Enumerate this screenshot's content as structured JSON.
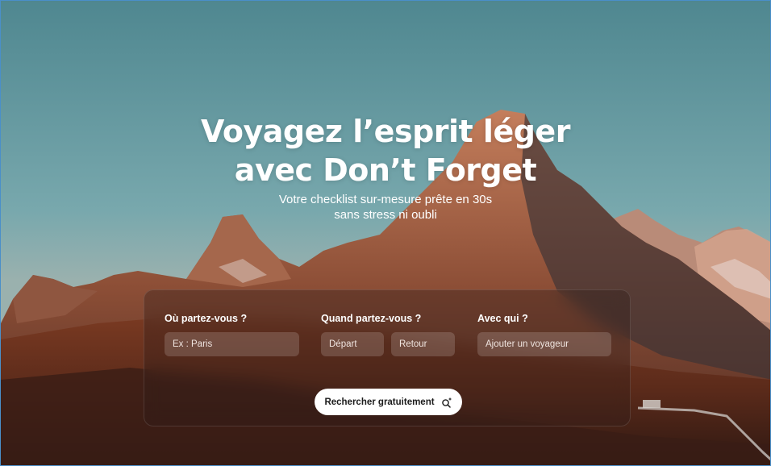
{
  "hero": {
    "headline_line1": "Voyagez l’esprit léger",
    "headline_line2": "avec Don’t Forget",
    "subtitle_line1": "Votre checklist sur-mesure prête en 30s",
    "subtitle_line2": "sans stress ni oubli"
  },
  "search": {
    "destination_label": "Où partez-vous ?",
    "destination_placeholder": "Ex : Paris",
    "dates_label": "Quand partez-vous ?",
    "departure_placeholder": "Départ",
    "return_placeholder": "Retour",
    "companions_label": "Avec qui ?",
    "companions_placeholder": "Ajouter un voyageur",
    "submit_label": "Rechercher gratuitement",
    "submit_icon": "sparkle-search-icon"
  },
  "colors": {
    "sky": "#6b9fa6",
    "mountain": "#9a5a3e",
    "button_bg": "#ffffff",
    "accent_border": "#4a8fc9"
  }
}
